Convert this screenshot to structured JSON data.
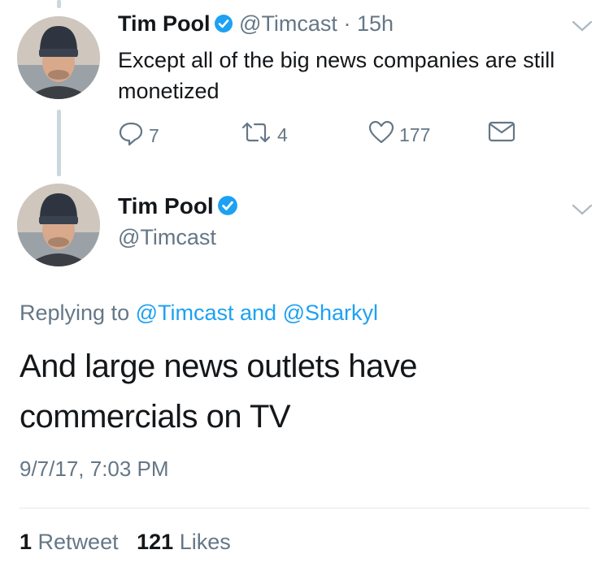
{
  "tweet1": {
    "name": "Tim Pool",
    "handle": "@Timcast",
    "time_sep": " · ",
    "time": "15h",
    "text": "Except all of the big news companies are still monetized",
    "actions": {
      "replies": "7",
      "retweets": "4",
      "likes": "177"
    }
  },
  "tweet2": {
    "name": "Tim Pool",
    "handle": "@Timcast",
    "replying_prefix": "Replying to ",
    "reply_to_1": "@Timcast",
    "reply_and": " and ",
    "reply_to_2": "@Sharkyl",
    "text": "And large news outlets have commercials on TV",
    "timestamp": "9/7/17, 7:03 PM",
    "retweets_count": "1",
    "retweets_label": "Retweet",
    "likes_count": "121",
    "likes_label": "Likes"
  },
  "icons": [
    "verified-badge-icon",
    "chevron-down-icon",
    "reply-icon",
    "retweet-icon",
    "heart-icon",
    "direct-message-icon"
  ],
  "colors": {
    "verified": "#1da1f2",
    "link": "#1da1f2",
    "secondary": "#657786",
    "thread_line": "#ccd6dd"
  }
}
